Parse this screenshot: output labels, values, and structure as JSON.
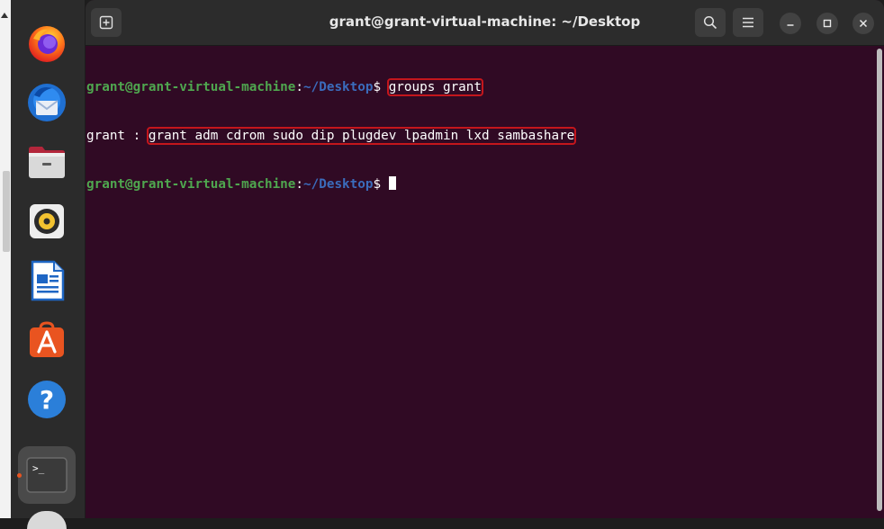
{
  "window": {
    "title": "grant@grant-virtual-machine: ~/Desktop"
  },
  "dock": {
    "items": [
      {
        "name": "firefox-icon"
      },
      {
        "name": "thunderbird-icon"
      },
      {
        "name": "files-icon"
      },
      {
        "name": "rhythmbox-icon"
      },
      {
        "name": "libreoffice-writer-icon"
      },
      {
        "name": "app-center-icon"
      },
      {
        "name": "help-icon"
      },
      {
        "name": "terminal-icon"
      }
    ]
  },
  "terminal": {
    "line1": {
      "user_host": "grant@grant-virtual-machine",
      "colon": ":",
      "path": "~/Desktop",
      "dollar": "$",
      "space": " ",
      "command": "groups grant"
    },
    "line2": {
      "prefix": "grant : ",
      "groups": "grant adm cdrom sudo dip plugdev lpadmin lxd sambashare"
    },
    "line3": {
      "user_host": "grant@grant-virtual-machine",
      "colon": ":",
      "path": "~/Desktop",
      "dollar": "$",
      "space": " "
    }
  },
  "colors": {
    "terminal_bg": "#300a24",
    "prompt_user": "#4fa74f",
    "prompt_path": "#3b6cbc",
    "highlight_box": "#c4161c",
    "accent": "#e95420"
  }
}
